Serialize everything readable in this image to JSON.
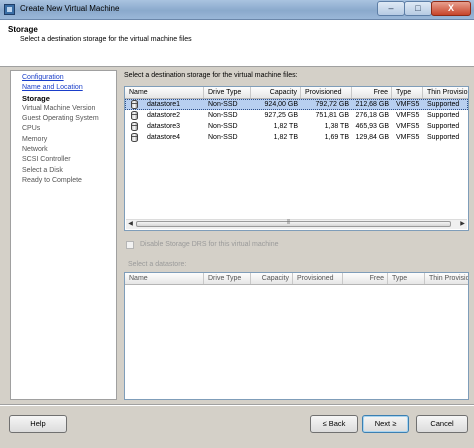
{
  "window": {
    "title": "Create New Virtual Machine",
    "controls": {
      "minimize": "–",
      "maximize": "□",
      "close": "X"
    }
  },
  "header": {
    "title": "Storage",
    "subtitle": "Select a destination storage for the virtual machine files"
  },
  "steps": [
    {
      "label": "Configuration",
      "state": "link"
    },
    {
      "label": "Name and Location",
      "state": "link"
    },
    {
      "label": "Storage",
      "state": "active"
    },
    {
      "label": "Virtual Machine Version",
      "state": "pending"
    },
    {
      "label": "Guest Operating System",
      "state": "pending"
    },
    {
      "label": "CPUs",
      "state": "pending"
    },
    {
      "label": "Memory",
      "state": "pending"
    },
    {
      "label": "Network",
      "state": "pending"
    },
    {
      "label": "SCSI Controller",
      "state": "pending"
    },
    {
      "label": "Select a Disk",
      "state": "pending"
    },
    {
      "label": "Ready to Complete",
      "state": "pending"
    }
  ],
  "main": {
    "instruction": "Select a destination storage for the virtual machine files:",
    "columns": [
      "Name",
      "Drive Type",
      "Capacity",
      "Provisioned",
      "Free",
      "Type",
      "Thin Provisioning"
    ],
    "rows": [
      {
        "name": "datastore1",
        "drive_type": "Non-SSD",
        "capacity": "924,00 GB",
        "provisioned": "792,72 GB",
        "free": "212,68 GB",
        "type": "VMFS5",
        "thin": "Supported",
        "selected": true
      },
      {
        "name": "datastore2",
        "drive_type": "Non-SSD",
        "capacity": "927,25 GB",
        "provisioned": "751,81 GB",
        "free": "276,18 GB",
        "type": "VMFS5",
        "thin": "Supported",
        "selected": false
      },
      {
        "name": "datastore3",
        "drive_type": "Non-SSD",
        "capacity": "1,82 TB",
        "provisioned": "1,38 TB",
        "free": "465,93 GB",
        "type": "VMFS5",
        "thin": "Supported",
        "selected": false
      },
      {
        "name": "datastore4",
        "drive_type": "Non-SSD",
        "capacity": "1,82 TB",
        "provisioned": "1,69 TB",
        "free": "129,84 GB",
        "type": "VMFS5",
        "thin": "Supported",
        "selected": false
      }
    ],
    "disable_drs_label": "Disable Storage DRS for this virtual machine",
    "select_datastore_label": "Select a datastore:",
    "lower_columns": [
      "Name",
      "Drive Type",
      "Capacity",
      "Provisioned",
      "Free",
      "Type",
      "Thin Provisioning"
    ]
  },
  "buttons": {
    "help": "Help",
    "back": "≤ Back",
    "next": "Next ≥",
    "cancel": "Cancel"
  },
  "colors": {
    "selection": "#b8cff0",
    "link": "#1a3ec9",
    "close_button": "#c7442a"
  }
}
